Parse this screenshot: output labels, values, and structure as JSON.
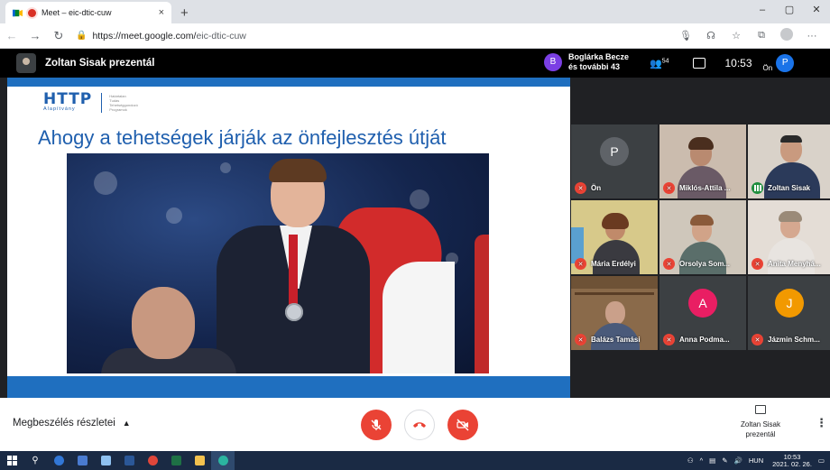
{
  "browser": {
    "tab_title": "Meet – eic-dtic-cuw",
    "tab_close": "×",
    "new_tab": "+",
    "url_host": "https://meet.google.com/",
    "url_path": "eic-dtic-cuw",
    "window_controls": [
      "–",
      "▢",
      "✕"
    ]
  },
  "meet": {
    "presenter_title": "Zoltan Sisak prezentál",
    "active_speaker": {
      "initial": "B",
      "line1": "Boglárka Becze",
      "line2": "és további 43"
    },
    "participant_count": "54",
    "time": "10:53",
    "self_label": "Ön",
    "self_initial": "P",
    "slide": {
      "logo_word": "HTTP",
      "logo_sub": "Alapítvány",
      "logo_lines": [
        "Határtalan",
        "Tudás",
        "Tehetséggondozó",
        "Programok"
      ],
      "title": "Ahogy a tehetségek járják az önfejlesztés útját"
    },
    "participants": [
      {
        "name": "Ön",
        "initial": "P",
        "muted": true
      },
      {
        "name": "Miklós-Attila ...",
        "muted": true
      },
      {
        "name": "Zoltan Sisak",
        "muted": false
      },
      {
        "name": "Mária Erdélyi",
        "muted": true
      },
      {
        "name": "Orsolya Som...",
        "muted": true
      },
      {
        "name": "Anita Menyhá...",
        "muted": true
      },
      {
        "name": "Balázs Tamási",
        "muted": true
      },
      {
        "name": "Anna Podma...",
        "initial": "A",
        "muted": true
      },
      {
        "name": "Jázmin Schm...",
        "initial": "J",
        "muted": true
      }
    ],
    "controls": {
      "details_label": "Megbeszélés részletei",
      "present_line1": "Zoltan Sisak",
      "present_line2": "prezentál"
    }
  },
  "taskbar": {
    "lang": "HUN",
    "clock_time": "10:53",
    "clock_date": "2021. 02. 26."
  },
  "colors": {
    "red": "#ea4335",
    "meet_bg": "#202124",
    "slide_blue": "#1f6fbf",
    "avatar_p": "#5f6368",
    "avatar_a": "#e91e63",
    "avatar_j": "#f29900"
  }
}
